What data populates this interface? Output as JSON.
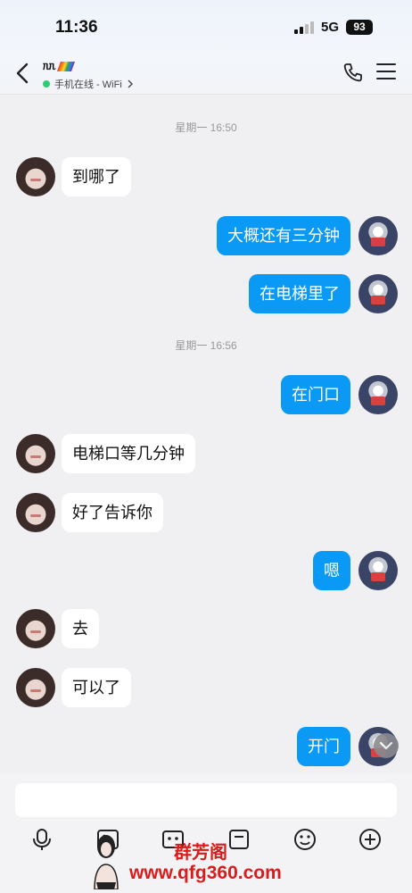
{
  "status_bar": {
    "time": "11:36",
    "network": "5G",
    "battery": "93"
  },
  "header": {
    "contact_name": "ᥰᥰ",
    "online_status": "手机在线 - WiFi",
    "online_color": "#2ecc71"
  },
  "colors": {
    "outgoing_bubble": "#0a99f5",
    "incoming_bubble": "#ffffff",
    "background": "#f0f0f2"
  },
  "messages": {
    "ts1": "星期一 16:50",
    "m1": "到哪了",
    "m2": "大概还有三分钟",
    "m3": "在电梯里了",
    "ts2": "星期一 16:56",
    "m4": "在门口",
    "m5": "电梯口等几分钟",
    "m6": "好了告诉你",
    "m7": "嗯",
    "m8": "去",
    "m9": "可以了",
    "m10": "开门"
  },
  "input": {
    "placeholder": ""
  },
  "toolbar": {
    "icons": [
      "microphone-icon",
      "image-icon",
      "camera-icon",
      "folder-icon",
      "emoji-icon",
      "plus-icon"
    ]
  },
  "watermark": {
    "site": "www.qfg360.com",
    "title": "群芳阁"
  }
}
